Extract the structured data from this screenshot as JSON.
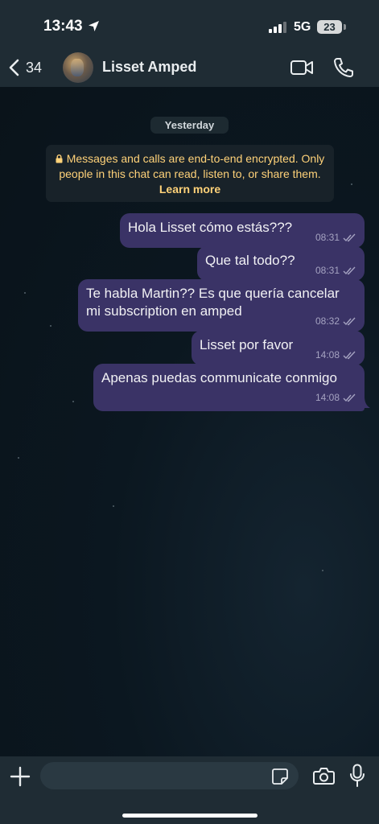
{
  "status_bar": {
    "time": "13:43",
    "network": "5G",
    "battery": "23"
  },
  "header": {
    "back_count": "34",
    "contact_name": "Lisset Amped"
  },
  "chat": {
    "date_label": "Yesterday",
    "encryption_notice": "Messages and calls are end-to-end encrypted. Only people in this chat can read, listen to, or share them.",
    "learn_more": "Learn more",
    "messages": [
      {
        "text": "Hola Lisset cómo estás???",
        "time": "08:31",
        "status": "read-ticks-icon"
      },
      {
        "text": "Que tal todo??",
        "time": "08:31",
        "status": "read-ticks-icon"
      },
      {
        "text": "Te habla Martin?? Es que quería cancelar mi subscription en amped",
        "time": "08:32",
        "status": "read-ticks-icon"
      },
      {
        "text": "Lisset por favor",
        "time": "14:08",
        "status": "read-ticks-icon"
      },
      {
        "text": "Apenas puedas communicate conmigo",
        "time": "14:08",
        "status": "read-ticks-icon"
      }
    ]
  },
  "input_bar": {
    "placeholder": ""
  },
  "colors": {
    "outgoing_bubble": "#3a3366",
    "header_bg": "#1f2c34",
    "notice_text": "#ffd279",
    "chat_bg": "#0b141a"
  }
}
